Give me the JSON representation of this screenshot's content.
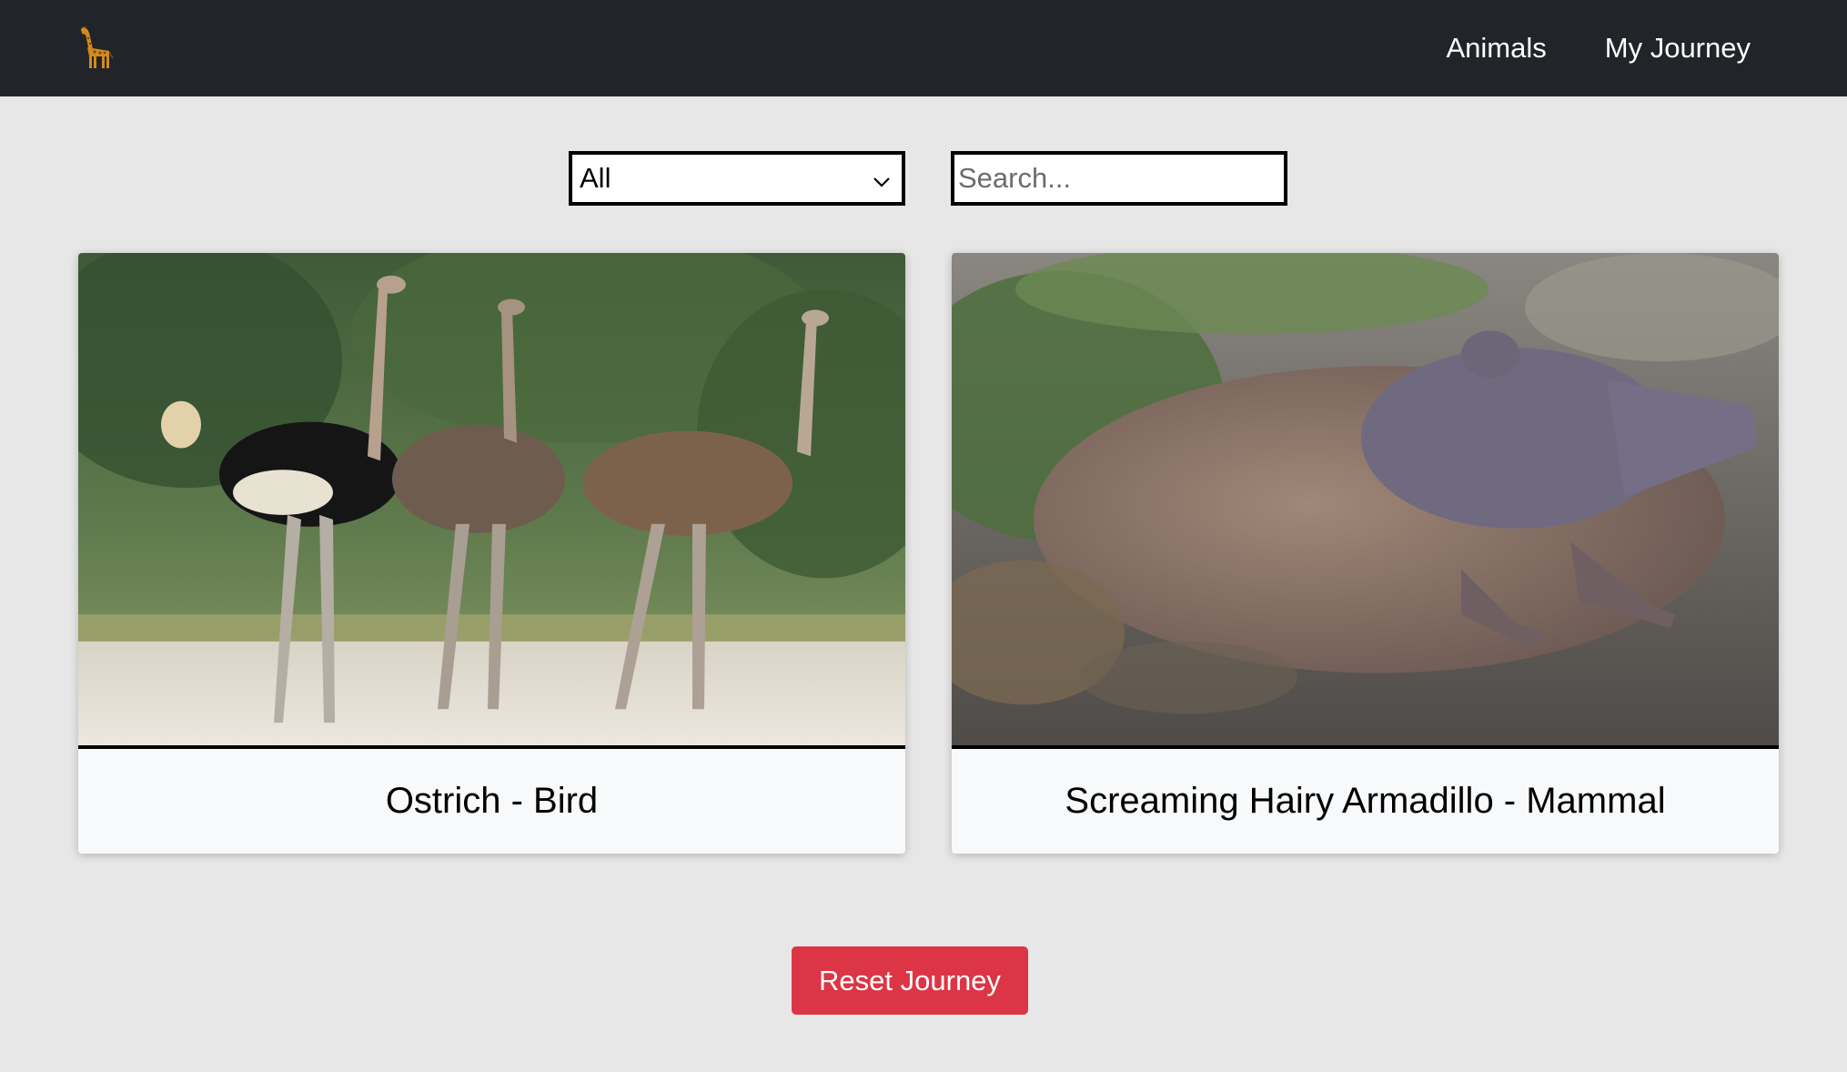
{
  "nav": {
    "brand_icon": "giraffe-icon",
    "links": [
      "Animals",
      "My Journey"
    ]
  },
  "filters": {
    "category_selected": "All",
    "search_placeholder": "Search..."
  },
  "cards": [
    {
      "title": "Ostrich - Bird",
      "image": "ostrich-photo"
    },
    {
      "title": "Screaming Hairy Armadillo - Mammal",
      "image": "armadillo-photo"
    }
  ],
  "actions": {
    "reset_label": "Reset Journey"
  },
  "colors": {
    "navbar": "#212529",
    "page_bg": "#e7e7e7",
    "reset_button": "#dc3545",
    "card_bg": "#f8f9fa"
  }
}
